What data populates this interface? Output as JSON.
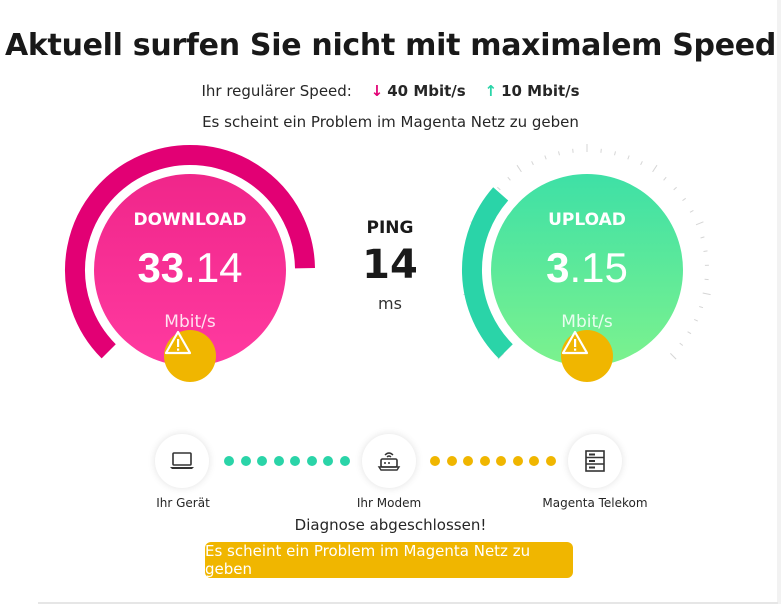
{
  "title": "Aktuell surfen Sie nicht mit maximalem Speed",
  "regular_speed": {
    "label": "Ihr regulärer Speed:",
    "download_icon": "download-arrow-icon",
    "download": "40 Mbit/s",
    "upload_icon": "upload-arrow-icon",
    "upload": "10 Mbit/s"
  },
  "problem_text": "Es scheint ein Problem im Magenta Netz zu geben",
  "download": {
    "label": "DOWNLOAD",
    "value_int": "33",
    "value_dec": ".14",
    "unit": "Mbit/s",
    "ratio": 0.83,
    "color": "#e20074",
    "warning_icon": "warning-icon"
  },
  "ping": {
    "label": "PING",
    "value": "14",
    "unit": "ms"
  },
  "upload": {
    "label": "UPLOAD",
    "value_int": "3",
    "value_dec": ".15",
    "unit": "Mbit/s",
    "ratio": 0.32,
    "color": "#2ad4a8",
    "warning_icon": "warning-icon"
  },
  "network": {
    "device": {
      "label": "Ihr Gerät",
      "icon": "laptop-icon"
    },
    "modem": {
      "label": "Ihr Modem",
      "icon": "router-icon"
    },
    "provider": {
      "label": "Magenta Telekom",
      "icon": "server-icon"
    },
    "link1_status_color": "#2ad4a8",
    "link2_status_color": "#f0b600"
  },
  "diagnosis": "Diagnose abgeschlossen!",
  "button_label": "Es scheint ein Problem im Magenta Netz zu geben"
}
